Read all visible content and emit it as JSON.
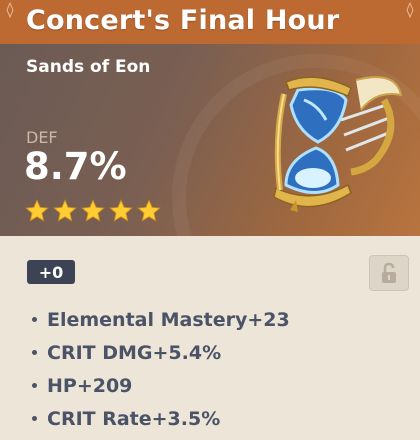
{
  "artifact": {
    "name": "Concert's Final Hour",
    "slot": "Sands of Eon",
    "main_stat": {
      "label": "DEF",
      "value": "8.7%"
    },
    "rarity_stars": 5,
    "level": "+0",
    "locked": false,
    "substats": [
      {
        "text": "Elemental Mastery+23"
      },
      {
        "text": "CRIT DMG+5.4%"
      },
      {
        "text": "HP+209"
      },
      {
        "text": "CRIT Rate+3.5%"
      }
    ]
  },
  "icons": {
    "artifact": "hourglass-artifact-icon",
    "lock": "unlock-icon",
    "star": "star-icon"
  },
  "colors": {
    "title_bar": "#bc6932",
    "star": "#ffcc32",
    "badge": "#3b4354",
    "body_bg": "#ece5d8",
    "substat_text": "#4b5366"
  }
}
